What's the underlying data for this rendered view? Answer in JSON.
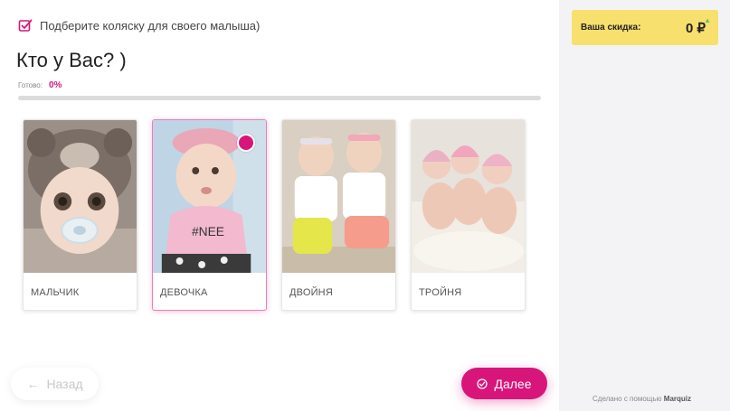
{
  "header": {
    "text": "Подберите коляску для своего малыша)"
  },
  "question": {
    "title": "Кто у Вас? )"
  },
  "progress": {
    "label": "Готово:",
    "percent_text": "0%",
    "percent": 0
  },
  "options": [
    {
      "label": "МАЛЬЧИК",
      "selected": false
    },
    {
      "label": "ДЕВОЧКА",
      "selected": true
    },
    {
      "label": "ДВОЙНЯ",
      "selected": false
    },
    {
      "label": "ТРОЙНЯ",
      "selected": false
    }
  ],
  "nav": {
    "back_label": "Назад",
    "next_label": "Далее"
  },
  "discount": {
    "label": "Ваша скидка:",
    "value": "0 ₽"
  },
  "credit": {
    "prefix": "Сделано с помощью",
    "brand": "Marquiz"
  },
  "colors": {
    "accent": "#d8157a",
    "discount_bg": "#f7e06d",
    "sidebar_bg": "#f3f3f5"
  }
}
